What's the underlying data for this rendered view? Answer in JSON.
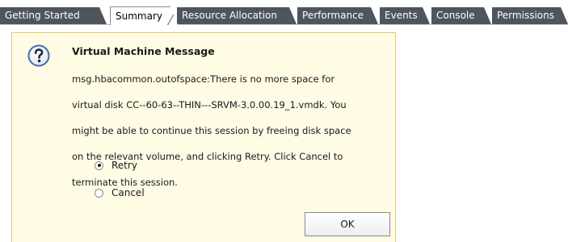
{
  "tabs": [
    {
      "label": "Getting Started",
      "active": false
    },
    {
      "label": "Summary",
      "active": true
    },
    {
      "label": "Resource Allocation",
      "active": false
    },
    {
      "label": "Performance",
      "active": false
    },
    {
      "label": "Events",
      "active": false
    },
    {
      "label": "Console",
      "active": false
    },
    {
      "label": "Permissions",
      "active": false
    }
  ],
  "message": {
    "icon": "question-icon",
    "title": "Virtual Machine Message",
    "body_lines": [
      "msg.hbacommon.outofspace:There is no more space for",
      "virtual disk CC--60-63--THIN---SRVM-3.0.00.19_1.vmdk. You",
      "might be able to continue this session by freeing disk space",
      "on the relevant volume, and clicking Retry. Click Cancel to",
      "terminate this session."
    ],
    "options": [
      {
        "label": "Retry",
        "selected": true
      },
      {
        "label": "Cancel",
        "selected": false
      }
    ],
    "ok_label": "OK"
  },
  "colors": {
    "tab_bg": "#4f555c",
    "panel_bg": "#fffbe5",
    "panel_border": "#e3c874",
    "icon_ring": "#3d6fa8"
  }
}
